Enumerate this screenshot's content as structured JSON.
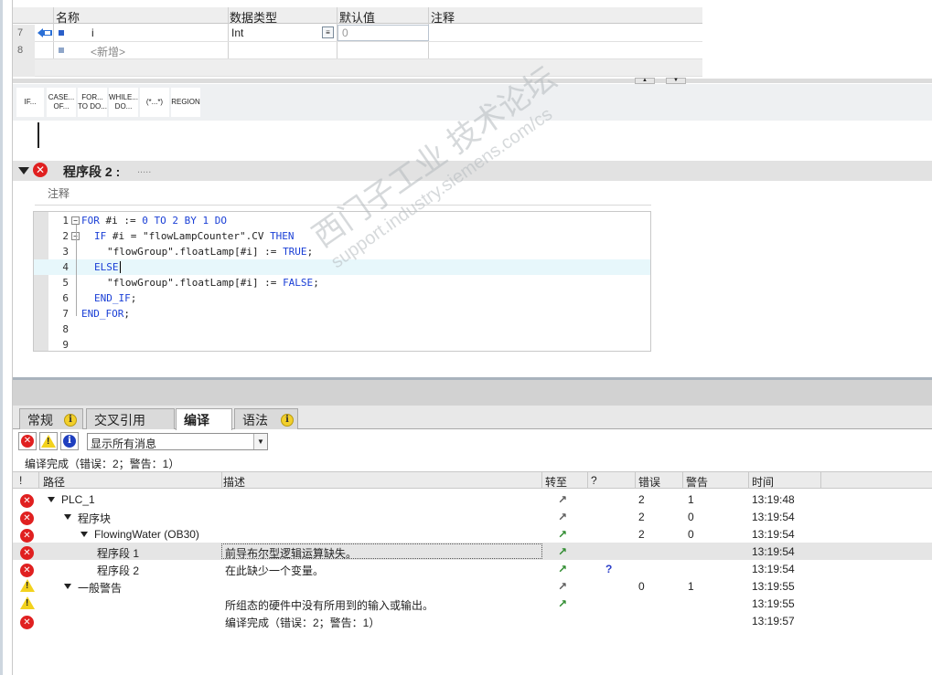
{
  "var_table": {
    "headers": [
      "名称",
      "数据类型",
      "默认值",
      "注释"
    ],
    "rows": [
      {
        "num": "7",
        "name": "i",
        "type": "Int",
        "default": "0"
      },
      {
        "num": "8",
        "name": "<新增>"
      }
    ]
  },
  "toolbar": {
    "buttons": [
      {
        "line1": "IF...",
        "line2": ""
      },
      {
        "line1": "CASE...",
        "line2": "OF..."
      },
      {
        "line1": "FOR...",
        "line2": "TO DO..."
      },
      {
        "line1": "WHILE...",
        "line2": "DO..."
      },
      {
        "line1": "(*...*)",
        "line2": ""
      },
      {
        "line1": "REGION",
        "line2": ""
      }
    ]
  },
  "network": {
    "title": "程序段 2 :",
    "dots": ".....",
    "comment_label": "注释"
  },
  "code": {
    "lines": [
      "1",
      "2",
      "3",
      "4",
      "5",
      "6",
      "7",
      "8",
      "9"
    ],
    "l1_kw1": "FOR",
    "l1_var": " #i",
    "l1_op": " := ",
    "l1_n0": "0",
    "l1_to": " TO ",
    "l1_n2": "2",
    "l1_by": " BY ",
    "l1_n1": "1",
    "l1_do": " DO",
    "l2_if": "IF",
    "l2_rest": " #i = \"flowLampCounter\".CV ",
    "l2_then": "THEN",
    "l3_rest": "\"flowGroup\".floatLamp[#i] := ",
    "l3_true": "TRUE",
    "l3_end": ";",
    "l4_else": "ELSE",
    "l5_rest": "\"flowGroup\".floatLamp[#i] := ",
    "l5_false": "FALSE",
    "l5_end": ";",
    "l6_endif": "END_IF",
    "l6_end": ";",
    "l7_endfor": "END_FOR",
    "l7_end": ";"
  },
  "tabs": [
    {
      "label": "常规",
      "info": true
    },
    {
      "label": "交叉引用",
      "info": false
    },
    {
      "label": "编译",
      "info": false,
      "active": true
    },
    {
      "label": "语法",
      "info": true
    }
  ],
  "filter": {
    "value": "显示所有消息"
  },
  "summary": "编译完成（错误：2；警告：1）",
  "results": {
    "headers": [
      "!",
      "路径",
      "描述",
      "转至",
      "?",
      "错误",
      "警告",
      "时间"
    ],
    "rows": [
      {
        "type": "error",
        "path": "PLC_1",
        "desc": "",
        "goto": "grey",
        "errors": "2",
        "warnings": "1",
        "time": "13:19:48",
        "indent": 0,
        "expand": true
      },
      {
        "type": "error",
        "path": "程序块",
        "desc": "",
        "goto": "grey",
        "errors": "2",
        "warnings": "0",
        "time": "13:19:54",
        "indent": 1,
        "expand": true
      },
      {
        "type": "error",
        "path": "FlowingWater (OB30)",
        "desc": "",
        "goto": "green",
        "errors": "2",
        "warnings": "0",
        "time": "13:19:54",
        "indent": 2,
        "expand": true
      },
      {
        "type": "error",
        "path": "程序段 1",
        "desc": "前导布尔型逻辑运算缺失。",
        "goto": "green",
        "errors": "",
        "warnings": "",
        "time": "13:19:54",
        "indent": 3,
        "selected": true
      },
      {
        "type": "error",
        "path": "程序段 2",
        "desc": "在此缺少一个变量。",
        "goto": "green",
        "help": "?",
        "errors": "",
        "warnings": "",
        "time": "13:19:54",
        "indent": 3
      },
      {
        "type": "warning",
        "path": "一般警告",
        "desc": "",
        "goto": "grey",
        "errors": "0",
        "warnings": "1",
        "time": "13:19:55",
        "indent": 1,
        "expand": true
      },
      {
        "type": "warning",
        "path": "",
        "desc": "所组态的硬件中没有所用到的输入或输出。",
        "goto": "green",
        "errors": "",
        "warnings": "",
        "time": "13:19:55",
        "indent": 0
      },
      {
        "type": "error",
        "path": "",
        "desc": "编译完成（错误：2；警告：1）",
        "goto": "",
        "errors": "",
        "warnings": "",
        "time": "13:19:57",
        "indent": 0
      }
    ]
  },
  "watermark": {
    "line1": "西门子工业 技术论坛",
    "line2": "support.industry.siemens.com/cs"
  }
}
